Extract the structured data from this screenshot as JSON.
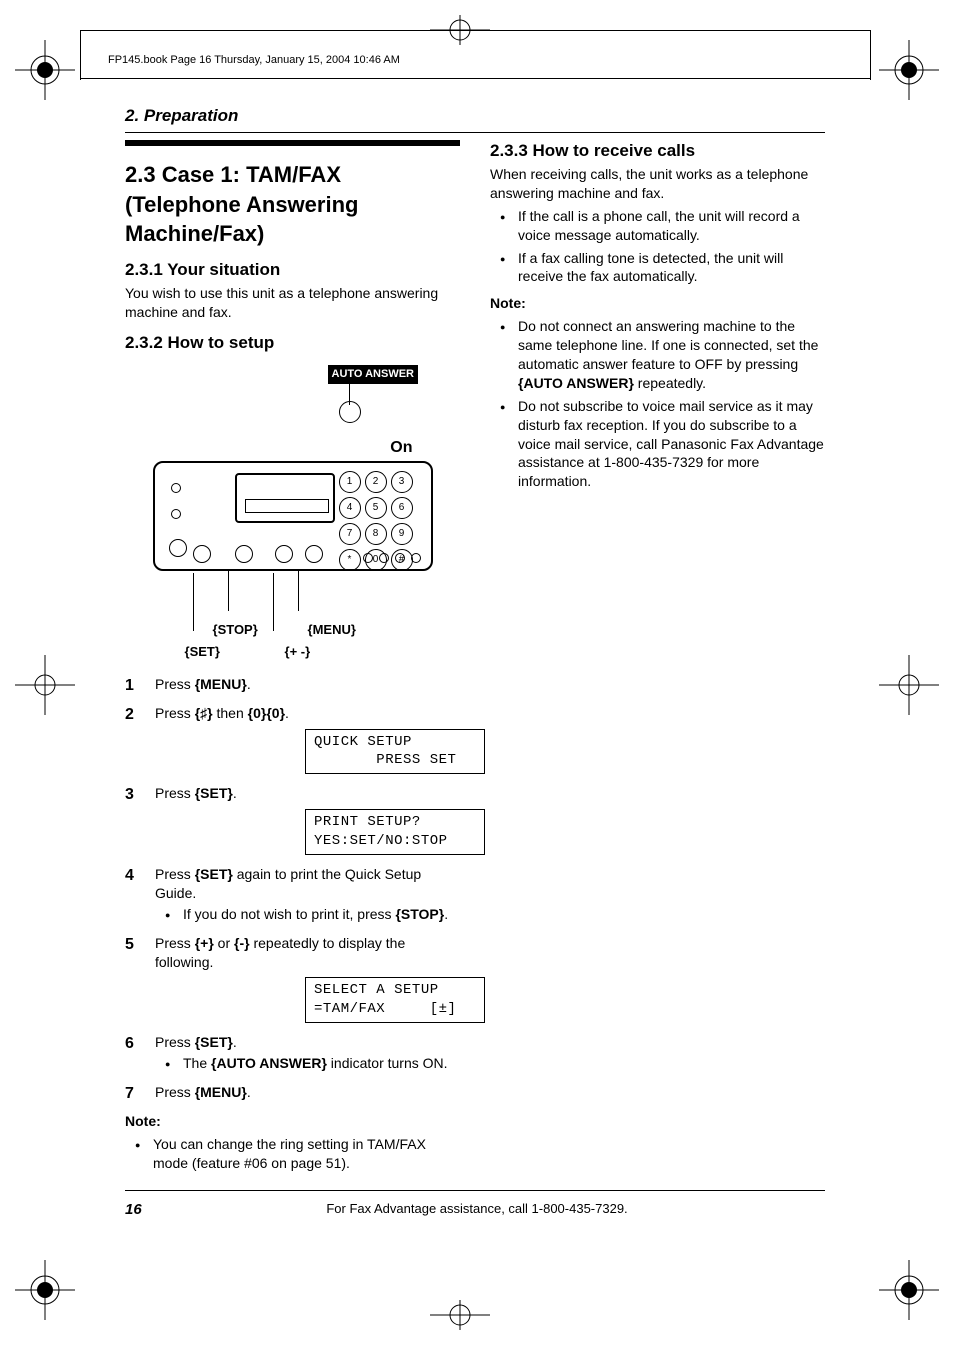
{
  "meta": {
    "bookline": "FP145.book  Page 16  Thursday, January 15, 2004  10:46 AM"
  },
  "chapter": "2. Preparation",
  "section": {
    "title": "2.3 Case 1: TAM/FAX (Telephone Answering Machine/Fax)",
    "sub1": {
      "title": "2.3.1 Your situation",
      "body": "You wish to use this unit as a telephone answering machine and fax."
    },
    "sub2": {
      "title": "2.3.2 How to setup"
    },
    "sub3": {
      "title": "2.3.3 How to receive calls",
      "intro": "When receiving calls, the unit works as a telephone answering machine and fax.",
      "bullets": [
        "If the call is a phone call, the unit will record a voice message automatically.",
        "If a fax calling tone is detected, the unit will receive the fax automatically."
      ],
      "notehead": "Note:",
      "notes_prefix1": "Do not connect an answering machine to the same telephone line. If one is connected, set the automatic answer feature to OFF by pressing ",
      "notes_key1": "AUTO ANSWER",
      "notes_suffix1": " repeatedly.",
      "note2": "Do not subscribe to voice mail service as it may disturb fax reception. If you do subscribe to a voice mail service, call Panasonic Fax Advantage assistance at 1-800-435-7329 for more information."
    }
  },
  "figure": {
    "auto_answer": "AUTO  ANSWER",
    "on": "On",
    "stop": "STOP",
    "menu": "MENU",
    "set": "SET",
    "plusminus": "+  -",
    "keypad": [
      "1",
      "2",
      "3",
      "4",
      "5",
      "6",
      "7",
      "8",
      "9",
      "*",
      "0",
      "#"
    ]
  },
  "steps": [
    {
      "p": "Press ",
      "k": "MENU",
      "s": "."
    },
    {
      "p": "Press ",
      "k": "♯",
      "m": " then ",
      "k2": "0",
      "k3": "0",
      "s": ".",
      "lcd": "QUICK SETUP\n       PRESS SET"
    },
    {
      "p": "Press ",
      "k": "SET",
      "s": ".",
      "lcd": "PRINT SETUP?\nYES:SET/NO:STOP"
    },
    {
      "p": "Press ",
      "k": "SET",
      "s": " again to print the Quick Setup Guide.",
      "bullets": [
        {
          "t": "If you do not wish to print it, press ",
          "k": "STOP",
          "s": "."
        }
      ]
    },
    {
      "p": "Press ",
      "k": "+",
      "m": " or ",
      "k2": "-",
      "s": " repeatedly to display the following.",
      "lcd": "SELECT A SETUP\n=TAM/FAX     [±]"
    },
    {
      "p": "Press ",
      "k": "SET",
      "s": ".",
      "bullets": [
        {
          "t": "The ",
          "k": "AUTO ANSWER",
          "s": " indicator turns ON."
        }
      ]
    },
    {
      "p": "Press ",
      "k": "MENU",
      "s": "."
    }
  ],
  "afternote": {
    "head": "Note:",
    "text": "You can change the ring setting in TAM/FAX mode (feature #06 on page 51)."
  },
  "footer": {
    "pagenum": "16",
    "text": "For Fax Advantage assistance, call 1-800-435-7329."
  }
}
